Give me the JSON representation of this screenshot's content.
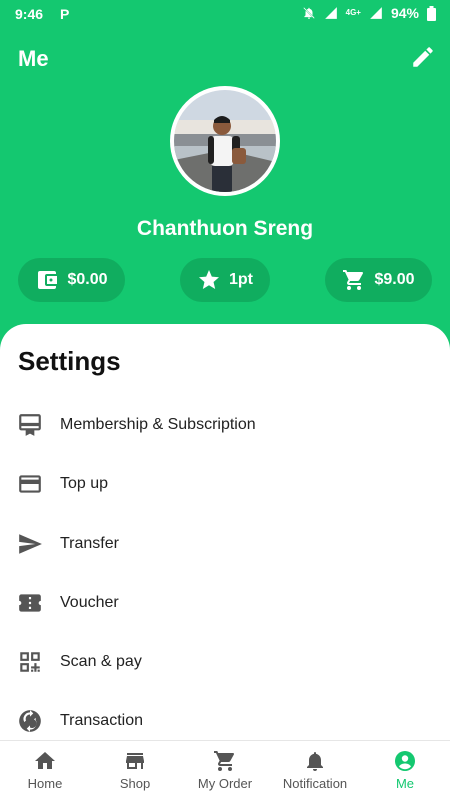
{
  "status_bar": {
    "time": "9:46",
    "left_icon": "P",
    "network": "4G+",
    "battery": "94%"
  },
  "header": {
    "title": "Me",
    "user_name": "Chanthuon Sreng"
  },
  "balances": {
    "wallet": "$0.00",
    "points": "1pt",
    "cart": "$9.00"
  },
  "settings": {
    "title": "Settings",
    "items": [
      {
        "label": "Membership & Subscription",
        "icon": "membership-card-icon"
      },
      {
        "label": "Top up",
        "icon": "credit-card-icon"
      },
      {
        "label": "Transfer",
        "icon": "send-icon"
      },
      {
        "label": "Voucher",
        "icon": "ticket-icon"
      },
      {
        "label": "Scan & pay",
        "icon": "qr-code-icon"
      },
      {
        "label": "Transaction",
        "icon": "sync-icon"
      }
    ]
  },
  "bottom_nav": [
    {
      "label": "Home",
      "icon": "home-icon",
      "active": false
    },
    {
      "label": "Shop",
      "icon": "store-icon",
      "active": false
    },
    {
      "label": "My Order",
      "icon": "cart-icon",
      "active": false
    },
    {
      "label": "Notification",
      "icon": "bell-icon",
      "active": false
    },
    {
      "label": "Me",
      "icon": "account-icon",
      "active": true
    }
  ],
  "colors": {
    "brand": "#14c870",
    "pill": "#10ad5f",
    "icon_gray": "#555555"
  }
}
